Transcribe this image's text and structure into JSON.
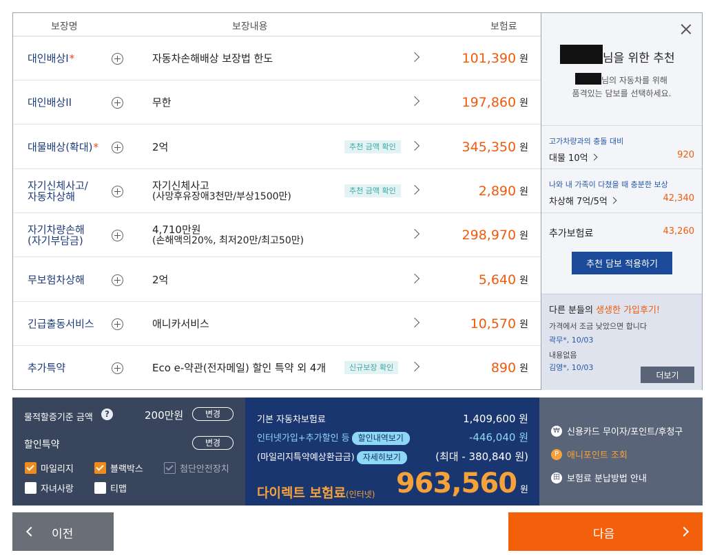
{
  "table": {
    "headers": {
      "name": "보장명",
      "content": "보장내용",
      "premium": "보험료"
    },
    "unit": "원",
    "rows": [
      {
        "name": "대인배상I",
        "required": "*",
        "desc": "자동차손해배상 보장법 한도",
        "sub": "",
        "tag": "",
        "price": "101,390"
      },
      {
        "name": "대인배상II",
        "required": "",
        "desc": "무한",
        "sub": "",
        "tag": "",
        "price": "197,860"
      },
      {
        "name": "대물배상(확대)",
        "required": "*",
        "desc": "2억",
        "sub": "",
        "tag": "추천 금액 확인",
        "price": "345,350"
      },
      {
        "name": "자기신체사고/\n자동차상해",
        "required": "",
        "desc": "자기신체사고",
        "sub": "(사망후유장애3천만/부상1500만)",
        "tag": "추천 금액 확인",
        "price": "2,890"
      },
      {
        "name": "자기차량손해\n(자기부담금)",
        "required": "",
        "desc": "4,710만원",
        "sub": "(손해액의20%, 최저20만/최고50만)",
        "tag": "",
        "price": "298,970"
      },
      {
        "name": "무보험차상해",
        "required": "",
        "desc": "2억",
        "sub": "",
        "tag": "",
        "price": "5,640"
      },
      {
        "name": "긴급출동서비스",
        "required": "",
        "desc": "애니카서비스",
        "sub": "",
        "tag": "",
        "price": "10,570"
      },
      {
        "name": "추가특약",
        "required": "",
        "desc": "Eco e-약관(전자메일) 할인 특약 외 4개",
        "sub": "",
        "tag": "신규보장 확인",
        "price": "890"
      }
    ]
  },
  "reco": {
    "headline": "님을 위한 추천",
    "line1": "님의 자동차를 위해",
    "line2": "품격있는 담보를 선택하세요.",
    "items": [
      {
        "caption": "고가차량과의 충돌 대비",
        "label": "대물 10억",
        "value": "920"
      },
      {
        "caption": "나와 내 가족이 다쳤을 때 충분한 보상",
        "label": "차상해 7억/5억",
        "value": "42,340"
      }
    ],
    "extra_label": "추가보험료",
    "extra_value": "43,260",
    "apply_button": "추천 담보 적용하기",
    "review_title_pre": "다른 분들의 ",
    "review_title_hl": "생생한 가입후기!",
    "reviews": [
      {
        "text": "가격에서 조금 낮았으면 합니다",
        "author": "곽무*, 10/03"
      },
      {
        "text": "내용없음",
        "author": "김영*, 10/03"
      }
    ],
    "more_button": "더보기"
  },
  "left": {
    "base_label": "물적할증기준 금액",
    "help_icon": "?",
    "base_amount": "200만원",
    "change_button": "변경",
    "discount_label": "할인특약",
    "checks": [
      {
        "label": "마일리지",
        "state": "on"
      },
      {
        "label": "블랙박스",
        "state": "on"
      },
      {
        "label": "첨단안전장치",
        "state": "disabled"
      },
      {
        "label": "자녀사랑",
        "state": "off"
      },
      {
        "label": "티맵",
        "state": "off"
      }
    ]
  },
  "mid": {
    "base_label": "기본 자동차보험료",
    "base_value": "1,409,600 원",
    "discount_label": "인터넷가입+추가할인 등",
    "discount_btn": "할인내역보기",
    "discount_value": "-446,040 원",
    "refund_label": "(마일리지특약예상환급금)",
    "refund_btn": "자세히보기",
    "refund_value": "(최대 - 380,840 원)",
    "direct_label": "다이렉트 보험료",
    "direct_sub": "(인터넷)",
    "direct_value": "963,560",
    "direct_unit": "원"
  },
  "right": {
    "options": [
      {
        "icon": "₩",
        "label": "신용카드 무이자/포인트/후청구"
      },
      {
        "icon": "P",
        "label": "애니포인트 조회"
      },
      {
        "icon": "田",
        "label": "보험료 분납방법 안내"
      }
    ]
  },
  "nav": {
    "prev": "이전",
    "next": "다음"
  },
  "colors": {
    "accent": "#f2600c",
    "navy": "#1a3670",
    "link": "#1b3a7a"
  }
}
